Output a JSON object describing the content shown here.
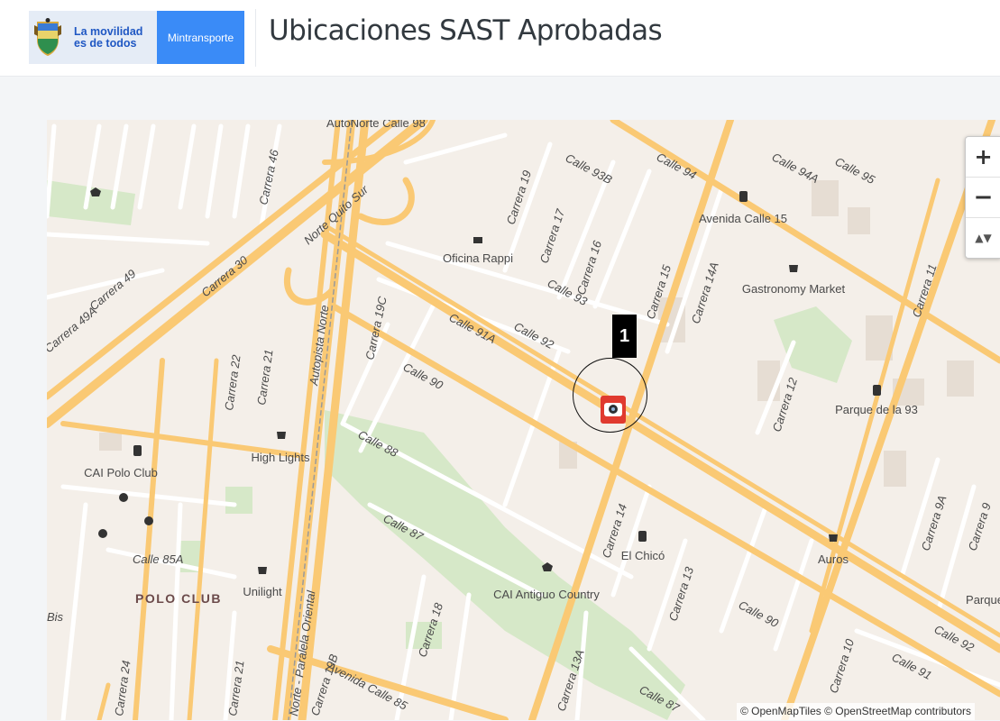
{
  "header": {
    "logo_line1": "La movilidad",
    "logo_line2": "es de todos",
    "logo_ministry": "Mintransporte",
    "title": "Ubicaciones SAST Aprobadas"
  },
  "map": {
    "zoom_in_label": "+",
    "zoom_out_label": "−",
    "north_label": "▲▼",
    "attribution": "© OpenMapTiles © OpenStreetMap contributors",
    "marker_label": "1",
    "marker_icon": "camera-icon",
    "streets": [
      "AutoNorte Calle 98",
      "Carrera 46",
      "Carrera 30",
      "Carrera 49",
      "Carrera 49A",
      "Norte Quito Sur",
      "Autopista Norte",
      "Carrera 19C",
      "Carrera 21",
      "Carrera 22",
      "Calle 90",
      "Calle 91A",
      "Calle 92",
      "Calle 93",
      "Calle 93B",
      "Calle 94",
      "Calle 94A",
      "Calle 95",
      "Carrera 19",
      "Carrera 17",
      "Carrera 16",
      "Carrera 15",
      "Carrera 14A",
      "Carrera 12",
      "Carrera 11",
      "Calle 88",
      "Calle 87",
      "Calle 85A",
      "Carrera 14",
      "Carrera 13",
      "Calle 90",
      "Calle 91",
      "Calle 92",
      "Carrera 9A",
      "Carrera 9",
      "Carrera 10",
      "Carrera 13A",
      "Carrera 18",
      "Carrera 24",
      "Carrera 21",
      "Avenida Calle 85",
      "Carrera 19B",
      "Norte - Paralela Oriental",
      "Calle 87",
      "Bis"
    ],
    "pois": [
      "Oficina Rappi",
      "Avenida Calle 15",
      "Gastronomy Market",
      "Parque de la 93",
      "High Lights",
      "CAI Polo Club",
      "POLO CLUB",
      "Unilight",
      "CAI Antiguo Country",
      "El Chicó",
      "Auros",
      "Parque"
    ],
    "colors": {
      "land": "#f4efe9",
      "major_road": "#fac974",
      "minor_road": "#ffffff",
      "park": "#d6e8c8",
      "label": "#4a4a4a",
      "marker": "#e03a2f"
    }
  }
}
